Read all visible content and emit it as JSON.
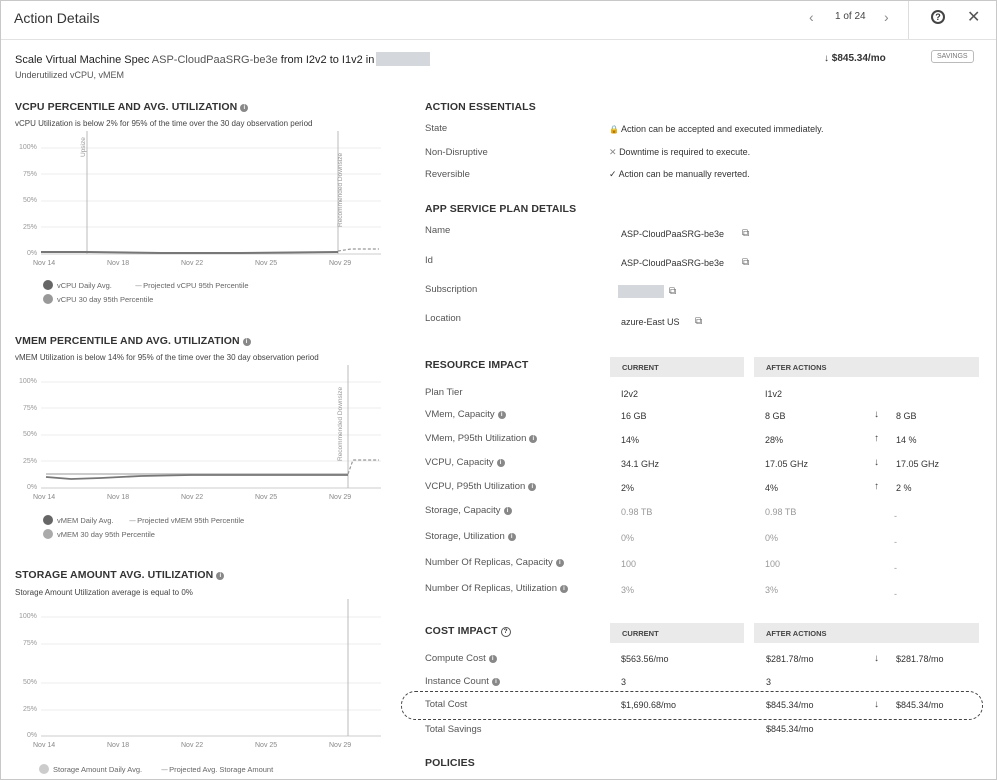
{
  "header": {
    "title": "Action Details",
    "pager_prev": "‹",
    "pager_text": "1 of 24",
    "pager_next": "›",
    "help": "?",
    "close": "✕"
  },
  "action": {
    "title_prefix": "Scale Virtual Machine Spec ",
    "resource": "ASP-CloudPaaSRG-be3e",
    "title_suffix": " from I2v2 to I1v2 in",
    "subtitle": "Underutilized vCPU, vMEM",
    "savings_amount": "↓ $845.34/mo",
    "savings_badge": "SAVINGS"
  },
  "charts": {
    "vcpu": {
      "heading": "VCPU PERCENTILE AND AVG. UTILIZATION",
      "subtitle": "vCPU Utilization is below 2% for 95% of the time over the 30 day observation period",
      "y_ticks": [
        "100%",
        "75%",
        "50%",
        "25%",
        "0%"
      ],
      "x_ticks": [
        "Nov 14",
        "Nov 18",
        "Nov 22",
        "Nov 25",
        "Nov 29"
      ],
      "marker_left": "Upsize",
      "marker_right": "Recommended Downsize",
      "legend_1": "vCPU Daily Avg.",
      "legend_2": "Projected vCPU 95th Percentile",
      "legend_3": "vCPU 30 day 95th Percentile"
    },
    "vmem": {
      "heading": "VMEM PERCENTILE AND AVG. UTILIZATION",
      "subtitle": "vMEM Utilization is below 14% for 95% of the time over the 30 day observation period",
      "y_ticks": [
        "100%",
        "75%",
        "50%",
        "25%",
        "0%"
      ],
      "x_ticks": [
        "Nov 14",
        "Nov 18",
        "Nov 22",
        "Nov 25",
        "Nov 29"
      ],
      "marker_right": "Recommended Downsize",
      "legend_1": "vMEM Daily Avg.",
      "legend_2": "Projected vMEM 95th Percentile",
      "legend_3": "vMEM 30 day 95th Percentile"
    },
    "storage": {
      "heading": "STORAGE AMOUNT AVG. UTILIZATION",
      "subtitle": "Storage Amount Utilization average is equal to 0%",
      "y_ticks": [
        "100%",
        "75%",
        "50%",
        "25%",
        "0%"
      ],
      "x_ticks": [
        "Nov 14",
        "Nov 18",
        "Nov 22",
        "Nov 25",
        "Nov 29"
      ],
      "legend_1": "Storage Amount Daily Avg.",
      "legend_2": "Projected Avg. Storage Amount"
    }
  },
  "essentials": {
    "heading": "ACTION ESSENTIALS",
    "rows": [
      {
        "label": "State",
        "icon": "lock-person-icon",
        "glyph": "🔒",
        "value": "Action can be accepted and executed immediately."
      },
      {
        "label": "Non-Disruptive",
        "icon": "x-icon",
        "glyph": "✕",
        "value": "Downtime is required to execute."
      },
      {
        "label": "Reversible",
        "icon": "check-icon",
        "glyph": "✓",
        "value": "Action can be manually reverted."
      }
    ]
  },
  "app_plan": {
    "heading": "APP SERVICE PLAN DETAILS",
    "rows": [
      {
        "label": "Name",
        "value": "ASP-CloudPaaSRG-be3e"
      },
      {
        "label": "Id",
        "value": "ASP-CloudPaaSRG-be3e"
      },
      {
        "label": "Subscription",
        "value": ""
      },
      {
        "label": "Location",
        "value": "azure-East US"
      }
    ]
  },
  "resource_impact": {
    "heading": "RESOURCE IMPACT",
    "col_current": "CURRENT",
    "col_after": "AFTER ACTIONS",
    "rows": [
      {
        "label": "Plan Tier",
        "current": "I2v2",
        "after": "I1v2",
        "dir": "",
        "delta": "",
        "info": false,
        "muted": false
      },
      {
        "label": "VMem, Capacity",
        "current": "16 GB",
        "after": "8 GB",
        "dir": "↓",
        "delta": "8 GB",
        "info": true,
        "muted": false
      },
      {
        "label": "VMem, P95th Utilization",
        "current": "14%",
        "after": "28%",
        "dir": "↑",
        "delta": "14 %",
        "info": true,
        "muted": false
      },
      {
        "label": "VCPU, Capacity",
        "current": "34.1 GHz",
        "after": "17.05 GHz",
        "dir": "↓",
        "delta": "17.05 GHz",
        "info": true,
        "muted": false
      },
      {
        "label": "VCPU, P95th Utilization",
        "current": "2%",
        "after": "4%",
        "dir": "↑",
        "delta": "2 %",
        "info": true,
        "muted": false
      },
      {
        "label": "Storage, Capacity",
        "current": "0.98 TB",
        "after": "0.98 TB",
        "dir": "",
        "delta": "-",
        "info": true,
        "muted": true
      },
      {
        "label": "Storage, Utilization",
        "current": "0%",
        "after": "0%",
        "dir": "",
        "delta": "-",
        "info": true,
        "muted": true
      },
      {
        "label": "Number Of Replicas, Capacity",
        "current": "100",
        "after": "100",
        "dir": "",
        "delta": "-",
        "info": true,
        "muted": true
      },
      {
        "label": "Number Of Replicas, Utilization",
        "current": "3%",
        "after": "3%",
        "dir": "",
        "delta": "-",
        "info": true,
        "muted": true
      }
    ]
  },
  "cost_impact": {
    "heading": "COST IMPACT",
    "col_current": "CURRENT",
    "col_after": "AFTER ACTIONS",
    "rows": [
      {
        "label": "Compute Cost",
        "current": "$563.56/mo",
        "after": "$281.78/mo",
        "dir": "↓",
        "delta": "$281.78/mo",
        "info": true
      },
      {
        "label": "Instance Count",
        "current": "3",
        "after": "3",
        "dir": "",
        "delta": "",
        "info": true
      },
      {
        "label": "Total Cost",
        "current": "$1,690.68/mo",
        "after": "$845.34/mo",
        "dir": "↓",
        "delta": "$845.34/mo",
        "info": false
      }
    ],
    "total_savings_label": "Total Savings",
    "total_savings_value": "$845.34/mo"
  },
  "policies": {
    "heading": "POLICIES"
  }
}
